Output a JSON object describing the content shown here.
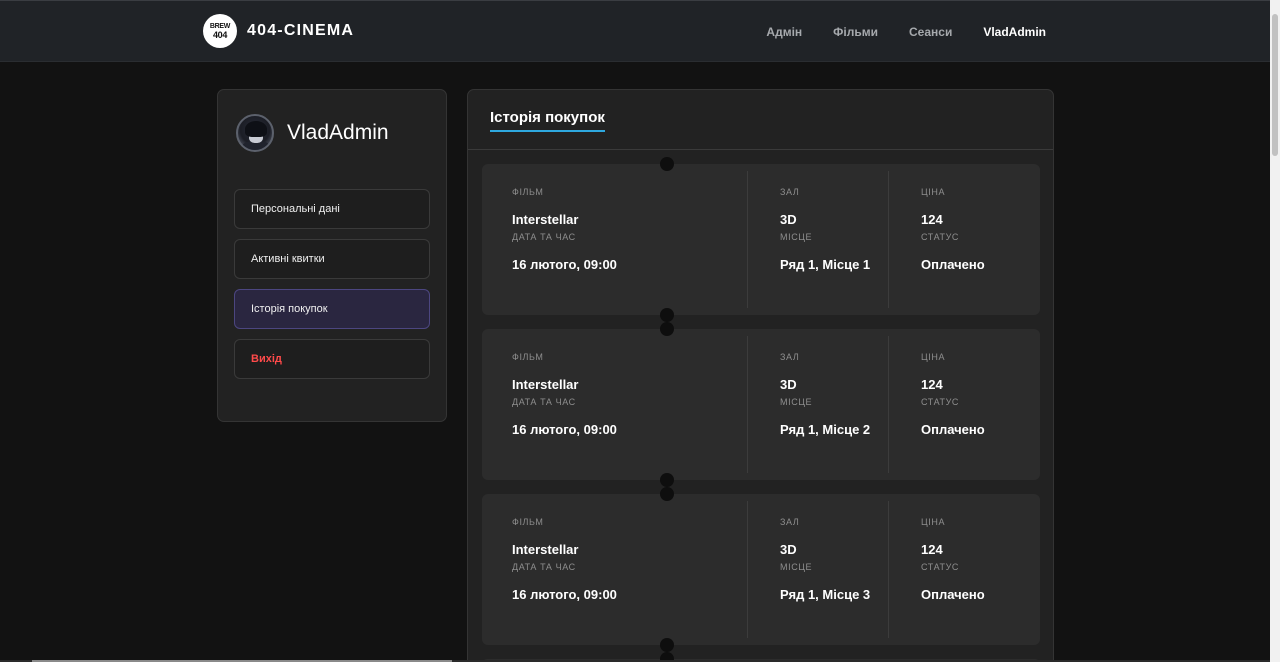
{
  "header": {
    "logo_text_top": "BREW",
    "logo_text_bottom": "404",
    "brand": "404-CINEMA",
    "nav": [
      "Адмін",
      "Фільми",
      "Сеанси",
      "VladAdmin"
    ]
  },
  "sidebar": {
    "username": "VladAdmin",
    "items": [
      {
        "label": "Персональні дані"
      },
      {
        "label": "Активні квитки"
      },
      {
        "label": "Історія покупок"
      },
      {
        "label": "Вихід"
      }
    ]
  },
  "main": {
    "title": "Історія покупок",
    "labels": {
      "film": "Фільм",
      "datetime": "Дата та час",
      "hall": "Зал",
      "seat": "Місце",
      "price": "Ціна",
      "status": "Статус"
    },
    "tickets": [
      {
        "film": "Interstellar",
        "datetime": "16 лютого, 09:00",
        "hall": "3D",
        "seat": "Ряд 1, Місце 1",
        "price": "124",
        "status": "Оплачено"
      },
      {
        "film": "Interstellar",
        "datetime": "16 лютого, 09:00",
        "hall": "3D",
        "seat": "Ряд 1, Місце 2",
        "price": "124",
        "status": "Оплачено"
      },
      {
        "film": "Interstellar",
        "datetime": "16 лютого, 09:00",
        "hall": "3D",
        "seat": "Ряд 1, Місце 3",
        "price": "124",
        "status": "Оплачено"
      }
    ]
  },
  "colors": {
    "accent": "#2ea8df",
    "logout": "#ff4a4a",
    "active_item": "#2a2640"
  }
}
